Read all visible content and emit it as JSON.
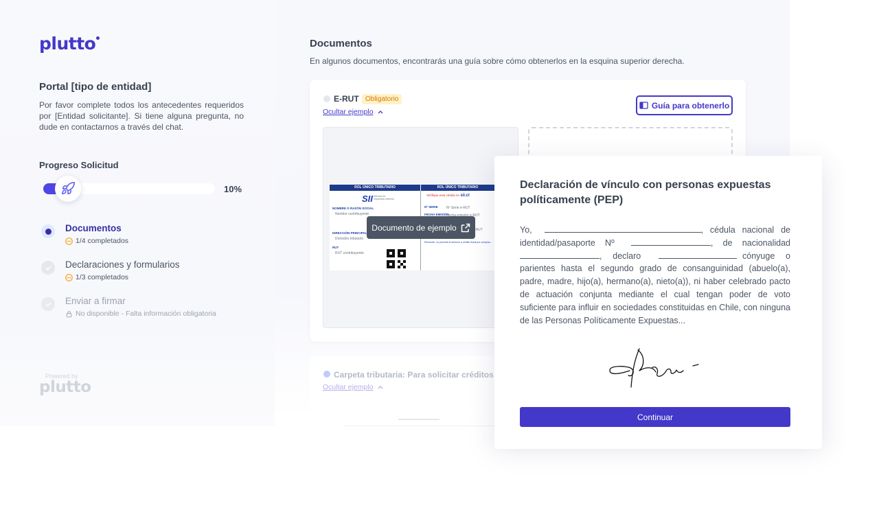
{
  "brand": {
    "name": "plutto",
    "accent": "#4338ca"
  },
  "sidebar": {
    "portal_title": "Portal [tipo de entidad]",
    "portal_desc": "Por favor complete todos los antecedentes requeridos por [Entidad solicitante]. Si tiene alguna pregunta, no dude en contactarnos a través del chat.",
    "progress": {
      "title": "Progreso Solicitud",
      "percent_label": "10%",
      "value": 0.1
    },
    "steps": [
      {
        "title": "Documentos",
        "sub": "1/4 completados",
        "state": "active",
        "icon": "pending-dots-icon"
      },
      {
        "title": "Declaraciones y formularios",
        "sub": "1/3 completados",
        "state": "pending",
        "icon": "pending-dots-icon"
      },
      {
        "title": "Enviar a firmar",
        "sub": "No disponible - Falta información obligatoria",
        "state": "disabled",
        "icon": "lock-icon"
      }
    ],
    "powered_by": "Powered by",
    "powered_logo": "plutto"
  },
  "main": {
    "title": "Documentos",
    "desc": "En algunos documentos, encontrarás una guía sobre cómo obtenerlos en la esquina superior derecha.",
    "doc1": {
      "name": "E-RUT",
      "badge": "Obligatorio",
      "toggle_example": "Ocultar ejemplo",
      "guide_button": "Guía para obtenerlo",
      "tooltip": "Documento de ejemplo",
      "rut": {
        "header_left": "ROL ÚNICO TRIBUTARIO",
        "header_right": "ROL ÚNICO TRIBUTARIO",
        "sii": "SII",
        "sii_sub": "Servicio de Impuestos Internos",
        "label_name": "NOMBRE O RAZÓN SOCIAL",
        "name": "Nombre contribuyente",
        "label_addr": "DIRECCIÓN PRINCIPAL (CASA MATRIZ)",
        "addr": "Domicilio tributario",
        "label_rut": "RUT",
        "rut": "RUT contribuyente",
        "verify": "Verifique esta cédula en",
        "verify_site": "sii.cl",
        "serie_label": "Nº SERIE",
        "serie": "Nº Serie e-RUT",
        "fecha_label": "FECHA EMISIÓN",
        "fecha": "Fecha emisión e-RUT",
        "extra": "e-RUT",
        "footer_note": "Recuerde: no procede el derecho a crédito fiscal por compras..."
      }
    },
    "doc2": {
      "name": "Carpeta tributaria: Para solicitar créditos",
      "toggle_example": "Ocultar ejemplo"
    }
  },
  "modal": {
    "title": "Declaración de vínculo con personas expuestas políticamente (PEP)",
    "p_yo": "Yo,",
    "p_cedula": ", cédula nacional de identidad/pasaporte Nº",
    "p_nac": ", de nacionalidad",
    "p_declaro": ", declaro",
    "p_rest": "cónyuge o parientes hasta el segundo grado de consanguinidad (abuelo(a), padre, madre, hijo(a), hermano(a), nieto(a)), ni haber celebrado pacto de actuación conjunta mediante el cual tengan poder de voto suficiente para influir en sociedades constituidas en Chile, con ninguna de las Personas Políticamente Expuestas...",
    "continue": "Continuar"
  }
}
